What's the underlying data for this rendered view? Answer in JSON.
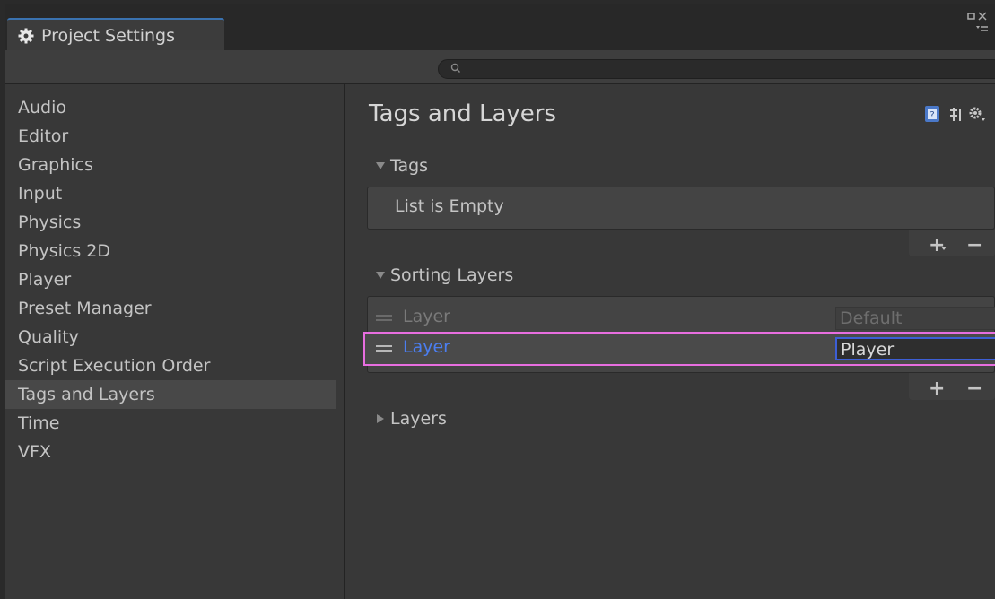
{
  "window": {
    "tab_title": "Project Settings",
    "tab_icon": "gear-icon",
    "search": {
      "placeholder": ""
    }
  },
  "sidebar": {
    "items": [
      {
        "label": "Audio",
        "active": false
      },
      {
        "label": "Editor",
        "active": false
      },
      {
        "label": "Graphics",
        "active": false
      },
      {
        "label": "Input",
        "active": false
      },
      {
        "label": "Physics",
        "active": false
      },
      {
        "label": "Physics 2D",
        "active": false
      },
      {
        "label": "Player",
        "active": false
      },
      {
        "label": "Preset Manager",
        "active": false
      },
      {
        "label": "Quality",
        "active": false
      },
      {
        "label": "Script Execution Order",
        "active": false
      },
      {
        "label": "Tags and Layers",
        "active": true
      },
      {
        "label": "Time",
        "active": false
      },
      {
        "label": "VFX",
        "active": false
      }
    ]
  },
  "main": {
    "title": "Tags and Layers",
    "tags": {
      "label": "Tags",
      "expanded": true,
      "empty_text": "List is Empty",
      "add": "+",
      "remove": "−"
    },
    "sorting_layers": {
      "label": "Sorting Layers",
      "expanded": true,
      "rows": [
        {
          "label": "Layer",
          "value": "Default",
          "state": "disabled"
        },
        {
          "label": "Layer",
          "value": "Player",
          "state": "selected"
        }
      ],
      "add": "+",
      "remove": "−"
    },
    "layers": {
      "label": "Layers",
      "expanded": false
    }
  },
  "colors": {
    "accent": "#3d5fd6",
    "selected_label": "#4b7ef0",
    "highlight_border": "#e86ee0",
    "tab_accent": "#3a72b0"
  }
}
